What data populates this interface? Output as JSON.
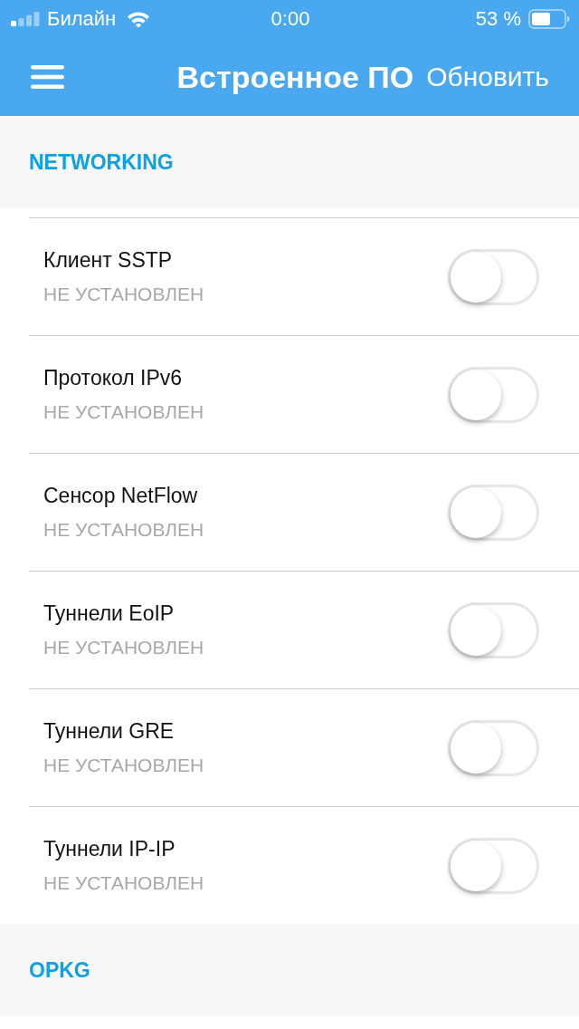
{
  "status_bar": {
    "carrier": "Билайн",
    "time": "0:00",
    "battery": "53 %"
  },
  "nav_bar": {
    "title": "Встроенное ПО",
    "action": "Обновить"
  },
  "sections": [
    {
      "title": "NETWORKING",
      "items": [
        {
          "name": "Клиент SSTP",
          "status": "НЕ УСТАНОВЛЕН",
          "on": false
        },
        {
          "name": "Протокол IPv6",
          "status": "НЕ УСТАНОВЛЕН",
          "on": false
        },
        {
          "name": "Сенсор NetFlow",
          "status": "НЕ УСТАНОВЛЕН",
          "on": false
        },
        {
          "name": "Туннели EoIP",
          "status": "НЕ УСТАНОВЛЕН",
          "on": false
        },
        {
          "name": "Туннели GRE",
          "status": "НЕ УСТАНОВЛЕН",
          "on": false
        },
        {
          "name": "Туннели IP-IP",
          "status": "НЕ УСТАНОВЛЕН",
          "on": false
        }
      ]
    },
    {
      "title": "OPKG"
    }
  ]
}
